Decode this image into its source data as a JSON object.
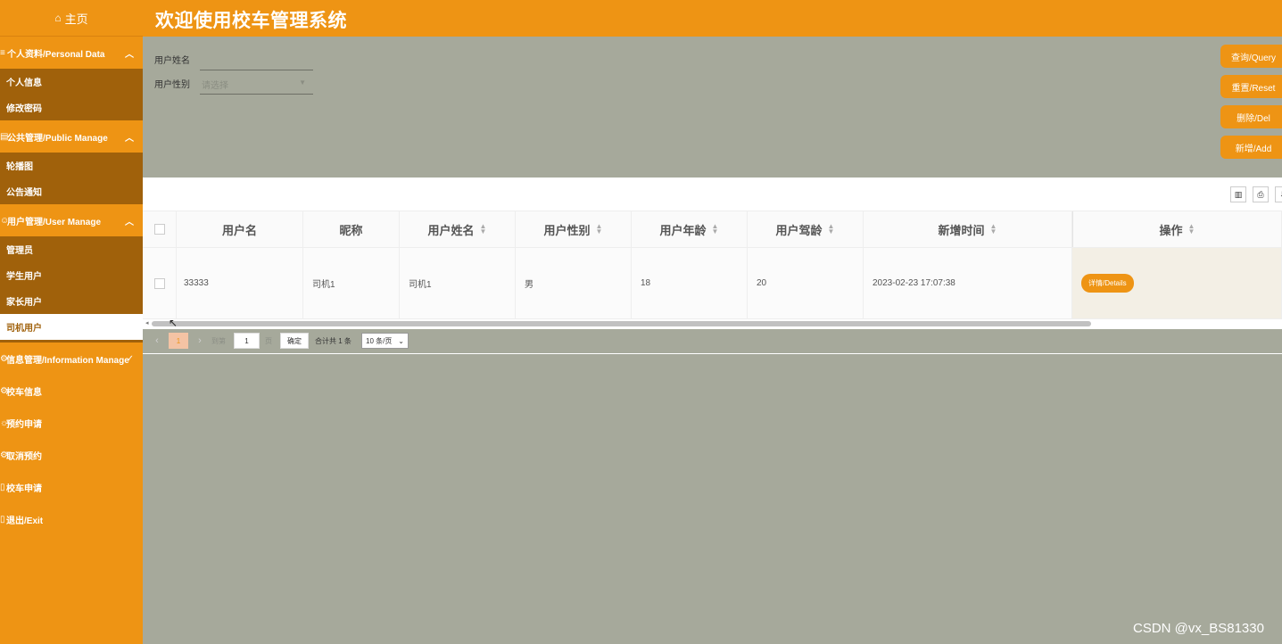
{
  "sidebar": {
    "home": "主页",
    "groups": [
      {
        "title": "个人资料/Personal Data",
        "items": [
          "个人信息",
          "修改密码"
        ]
      },
      {
        "title": "公共管理/Public Manage",
        "items": [
          "轮播图",
          "公告通知"
        ]
      },
      {
        "title": "用户管理/User Manage",
        "items": [
          "管理员",
          "学生用户",
          "家长用户",
          "司机用户"
        ]
      }
    ],
    "info_group": "信息管理/Information Manage",
    "plain_items": [
      "校车信息",
      "预约申请",
      "取消预约",
      "校车申请",
      "退出/Exit"
    ]
  },
  "header": {
    "title": "欢迎使用校车管理系统"
  },
  "search": {
    "name_label": "用户姓名",
    "gender_label": "用户性别",
    "gender_placeholder": "请选择"
  },
  "actions": [
    "查询/Query",
    "重置/Reset",
    "删除/Del",
    "新增/Add"
  ],
  "table": {
    "columns": [
      "用户名",
      "昵称",
      "用户姓名",
      "用户性别",
      "用户年龄",
      "用户驾龄",
      "新增时间",
      "操作"
    ],
    "rows": [
      {
        "username": "33333",
        "nickname": "司机1",
        "name": "司机1",
        "gender": "男",
        "age": "18",
        "driving_years": "20",
        "created": "2023-02-23 17:07:38",
        "action": "详情/Details"
      }
    ]
  },
  "pagination": {
    "current": "1",
    "goto_label": "到第",
    "goto_value": "1",
    "page_unit": "页",
    "confirm": "确定",
    "total": "合计共 1 条",
    "page_size": "10 条/页"
  },
  "watermark": "CSDN @vx_BS81330"
}
